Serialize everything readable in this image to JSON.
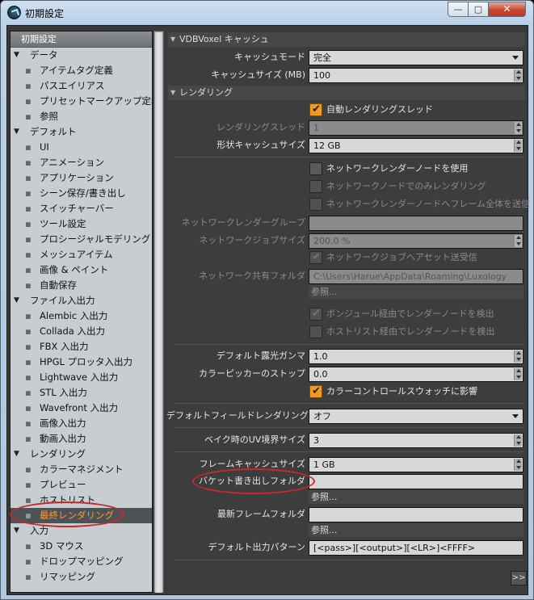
{
  "window": {
    "title": "初期設定",
    "min_glyph": "—",
    "max_glyph": "▢",
    "close_glyph": "✕"
  },
  "sidebar": {
    "header": "初期設定",
    "items": [
      {
        "label": "データ",
        "group": true
      },
      {
        "label": "アイテムタグ定義"
      },
      {
        "label": "パスエイリアス"
      },
      {
        "label": "プリセットマークアップ定義"
      },
      {
        "label": "参照"
      },
      {
        "label": "デフォルト",
        "group": true
      },
      {
        "label": "UI"
      },
      {
        "label": "アニメーション"
      },
      {
        "label": "アプリケーション"
      },
      {
        "label": "シーン保存/書き出し"
      },
      {
        "label": "スイッチャーバー"
      },
      {
        "label": "ツール設定"
      },
      {
        "label": "プロシージャルモデリング"
      },
      {
        "label": "メッシュアイテム"
      },
      {
        "label": "画像 & ペイント"
      },
      {
        "label": "自動保存"
      },
      {
        "label": "ファイル入出力",
        "group": true
      },
      {
        "label": "Alembic 入出力"
      },
      {
        "label": "Collada 入出力"
      },
      {
        "label": "FBX 入出力"
      },
      {
        "label": "HPGL プロッタ入出力"
      },
      {
        "label": "Lightwave 入出力"
      },
      {
        "label": "STL 入出力"
      },
      {
        "label": "Wavefront 入出力"
      },
      {
        "label": "画像入出力"
      },
      {
        "label": "動画入出力"
      },
      {
        "label": "レンダリング",
        "group": true
      },
      {
        "label": "カラーマネジメント"
      },
      {
        "label": "プレビュー"
      },
      {
        "label": "ホストリスト"
      },
      {
        "label": "最終レンダリング",
        "selected": true
      },
      {
        "label": "入力",
        "group": true
      },
      {
        "label": "3D マウス"
      },
      {
        "label": "ドロップマッピング"
      },
      {
        "label": "リマッピング"
      }
    ]
  },
  "main": {
    "section_vdb": "VDBVoxel キャッシュ",
    "cache_mode_label": "キャッシュモード",
    "cache_mode_value": "完全",
    "cache_size_label": "キャッシュサイズ (MB)",
    "cache_size_value": "100",
    "section_render": "レンダリング",
    "auto_threads_label": "自動レンダリングスレッド",
    "threads_label": "レンダリングスレッド",
    "threads_value": "1",
    "geo_cache_label": "形状キャッシュサイズ",
    "geo_cache_value": "12 GB",
    "net_use_label": "ネットワークレンダーノードを使用",
    "net_only_label": "ネットワークノードでのみレンダリング",
    "net_frame_label": "ネットワークレンダーノードへフレーム全体を送信",
    "net_group_label": "ネットワークレンダーグループ",
    "net_group_value": "",
    "net_job_size_label": "ネットワークジョブサイズ",
    "net_job_size_value": "200.0 %",
    "net_asset_label": "ネットワークジョブへアセット送受信",
    "net_folder_label": "ネットワーク共有フォルダ",
    "net_folder_value": "C:\\Users\\Harue\\AppData\\Roaming\\Luxology",
    "browse_label": "参照...",
    "bonjour_label": "ボンジュール経由でレンダーノードを検出",
    "hostlist_label": "ホストリスト経由でレンダーノードを検出",
    "gamma_label": "デフォルト露光ガンマ",
    "gamma_value": "1.0",
    "picker_stop_label": "カラーピッカーのストップ",
    "picker_stop_value": "0.0",
    "swatch_label": "カラーコントロールスウォッチに影響",
    "field_render_label": "デフォルトフィールドレンダリング",
    "field_render_value": "オフ",
    "uv_border_label": "ベイク時のUV境界サイズ",
    "uv_border_value": "3",
    "frame_cache_label": "フレームキャッシュサイズ",
    "frame_cache_value": "1 GB",
    "bucket_folder_label": "バケット書き出しフォルダ",
    "bucket_folder_value": "",
    "latest_frame_label": "最新フレームフォルダ",
    "latest_frame_value": "",
    "output_pattern_label": "デフォルト出力パターン",
    "output_pattern_value": "[<pass>][<output>][<LR>]<FFFF>",
    "next_label": ">>"
  },
  "colors": {
    "accent": "#f39a1c",
    "highlight_ring": "#c8282a",
    "selected_text": "#ff9a2a"
  }
}
